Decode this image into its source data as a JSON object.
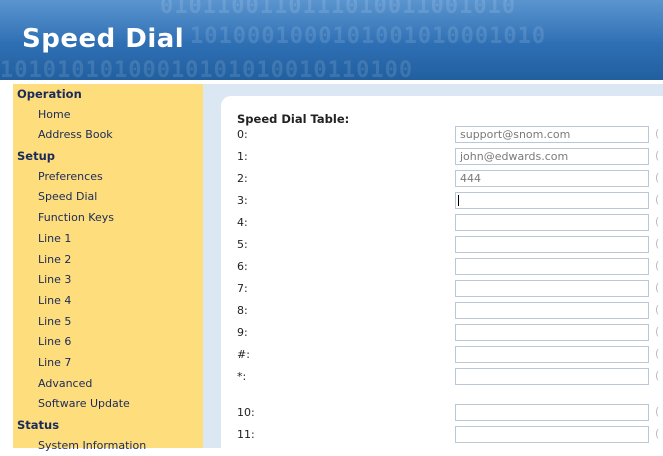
{
  "header": {
    "title": "Speed Dial"
  },
  "sidebar": {
    "sections": [
      {
        "label": "Operation",
        "items": [
          "Home",
          "Address Book"
        ]
      },
      {
        "label": "Setup",
        "items": [
          "Preferences",
          "Speed Dial",
          "Function Keys",
          "Line 1",
          "Line 2",
          "Line 3",
          "Line 4",
          "Line 5",
          "Line 6",
          "Line 7",
          "Advanced",
          "Software Update"
        ]
      },
      {
        "label": "Status",
        "items": [
          "System Information"
        ]
      }
    ]
  },
  "main": {
    "table_title": "Speed Dial Table:",
    "rows": [
      {
        "label": "0:",
        "value": "support@snom.com"
      },
      {
        "label": "1:",
        "value": "john@edwards.com"
      },
      {
        "label": "2:",
        "value": "444"
      },
      {
        "label": "3:",
        "value": ""
      },
      {
        "label": "4:",
        "value": ""
      },
      {
        "label": "5:",
        "value": ""
      },
      {
        "label": "6:",
        "value": ""
      },
      {
        "label": "7:",
        "value": ""
      },
      {
        "label": "8:",
        "value": ""
      },
      {
        "label": "9:",
        "value": ""
      },
      {
        "label": "#:",
        "value": ""
      },
      {
        "label": "*:",
        "value": ""
      },
      {
        "label": "10:",
        "value": ""
      },
      {
        "label": "11:",
        "value": ""
      }
    ],
    "row_suffix": "(",
    "focused_row": 3
  }
}
